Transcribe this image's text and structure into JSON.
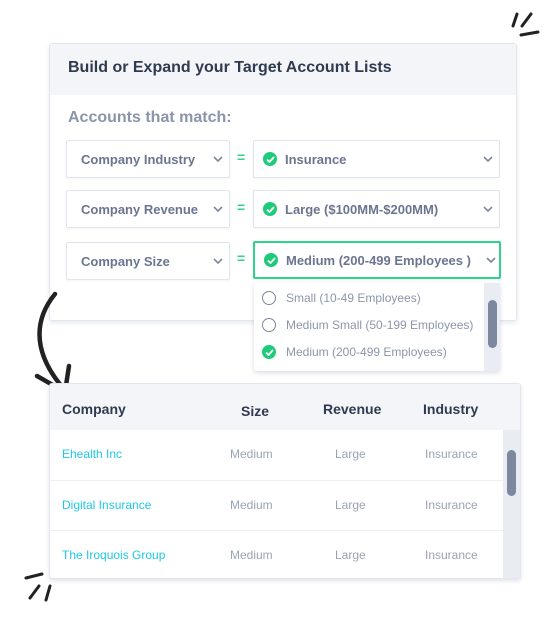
{
  "card": {
    "title": "Build or Expand your Target Account Lists",
    "subheading": "Accounts that match:"
  },
  "filters": [
    {
      "field": "Company Industry",
      "operator": "=",
      "value": "Insurance",
      "active": false
    },
    {
      "field": "Company Revenue",
      "operator": "=",
      "value": "Large ($100MM-$200MM)",
      "active": false
    },
    {
      "field": "Company Size",
      "operator": "=",
      "value": "Medium (200-499 Employees )",
      "active": true
    }
  ],
  "size_dropdown": {
    "options": [
      {
        "label": "Small (10-49 Employees)",
        "selected": false
      },
      {
        "label": "Medium Small (50-199 Employees)",
        "selected": false
      },
      {
        "label": "Medium (200-499 Employees)",
        "selected": true
      }
    ]
  },
  "results_table": {
    "columns": [
      "Company",
      "Size",
      "Revenue",
      "Industry"
    ],
    "rows": [
      {
        "company": "Ehealth Inc",
        "size": "Medium",
        "revenue": "Large",
        "industry": "Insurance"
      },
      {
        "company": "Digital Insurance",
        "size": "Medium",
        "revenue": "Large",
        "industry": "Insurance"
      },
      {
        "company": "The Iroquois Group",
        "size": "Medium",
        "revenue": "Large",
        "industry": "Insurance"
      }
    ]
  },
  "colors": {
    "accent_green": "#2fd38a",
    "link_cyan": "#1fc8e6",
    "heading": "#303a4f"
  }
}
